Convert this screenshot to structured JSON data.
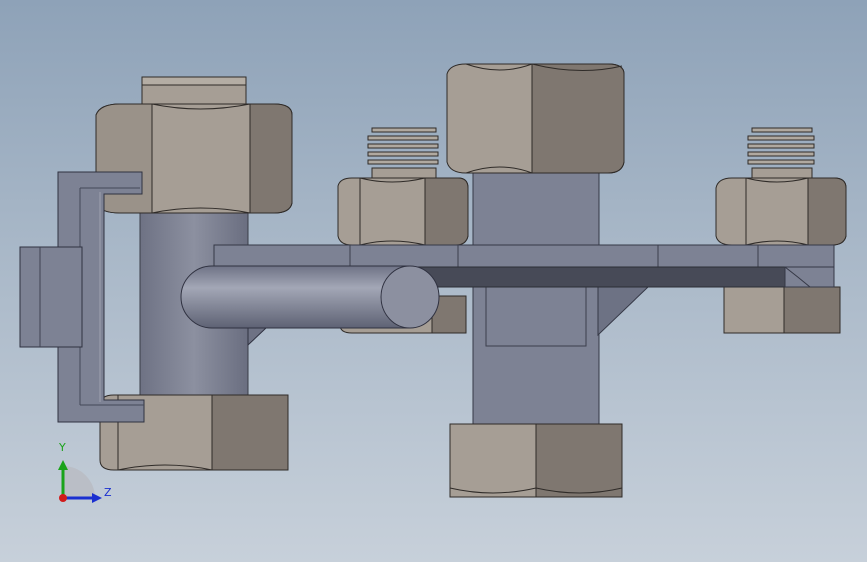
{
  "viewport": {
    "background_top": "#8ea2b8",
    "background_bottom": "#c7d0da"
  },
  "colors": {
    "nut_face_light": "#a69e95",
    "nut_face_dark": "#7f7770",
    "nut_outline": "#2f2b28",
    "steel_blue": "#7d8294",
    "steel_dark": "#5d6273",
    "steel_light": "#9296a6",
    "strap_dark": "#474a57",
    "axis_y": "#1aa31a",
    "axis_z": "#1a2fd0",
    "axis_origin": "#d01a1a"
  },
  "triad": {
    "y_label": "Y",
    "z_label": "Z",
    "icon": "coordinate-triad-icon"
  }
}
